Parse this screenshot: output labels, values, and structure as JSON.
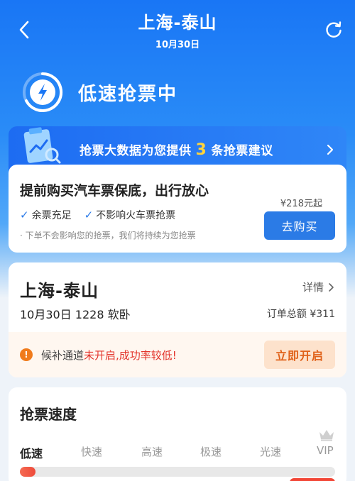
{
  "nav": {
    "title": "上海-泰山",
    "date": "10月30日"
  },
  "status": {
    "text": "低速抢票中"
  },
  "advice": {
    "prefix": "抢票大数据为您提供",
    "count": "3",
    "suffix": "条抢票建议"
  },
  "bus_card": {
    "title": "提前购买汽车票保底，出行放心",
    "checks": [
      "余票充足",
      "不影响火车票抢票"
    ],
    "note": "· 下单不会影响您的抢票，我们将持续为您抢票",
    "price": "¥218元起",
    "buy_label": "去购买"
  },
  "order_card": {
    "route": "上海-泰山",
    "detail_label": "详情",
    "info": "10月30日 1228 软卧",
    "total": "订单总额 ¥311",
    "waitlist": {
      "text_prefix": "候补通道",
      "text_red": "未开启,成功率较低!",
      "button_label": "立即开启"
    }
  },
  "speed_card": {
    "title": "抢票速度",
    "levels": [
      "低速",
      "快速",
      "高速",
      "极速",
      "光速",
      "VIP"
    ],
    "active_level": "低速",
    "progress_fraction": 0.05
  },
  "colors": {
    "brand_blue": "#1976f5",
    "button_blue": "#2b7be6",
    "accent_yellow": "#ffd43b",
    "warning_orange": "#f07b1c",
    "alert_red": "#e3342b"
  }
}
